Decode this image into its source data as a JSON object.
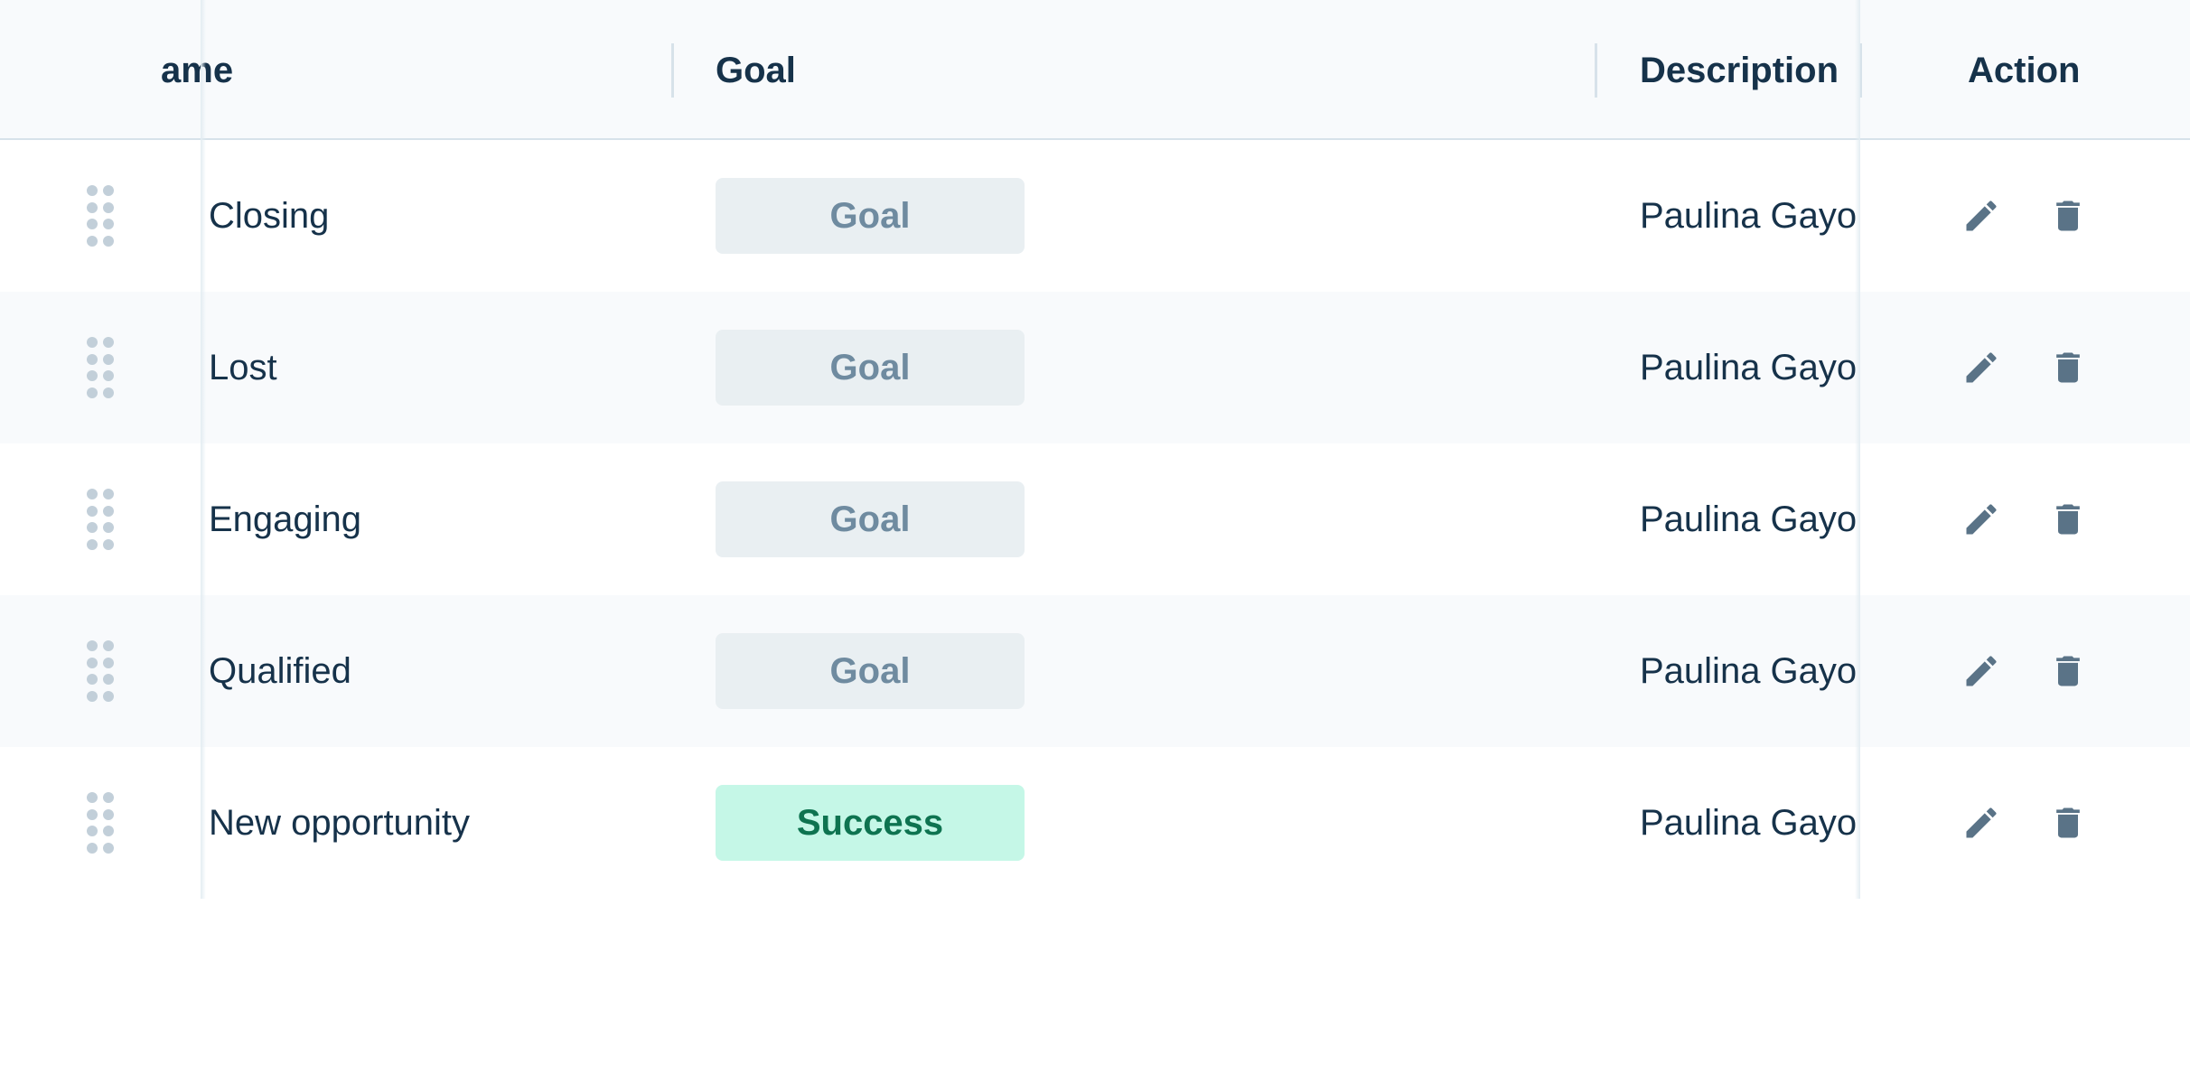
{
  "table": {
    "columns": {
      "name": "ame",
      "goal": "Goal",
      "description": "Description",
      "action": "Action"
    },
    "rows": [
      {
        "name": "Closing",
        "goal": "Goal",
        "goal_status": "neutral",
        "description": "Paulina Gayoso"
      },
      {
        "name": "Lost",
        "goal": "Goal",
        "goal_status": "neutral",
        "description": "Paulina Gayoso"
      },
      {
        "name": "Engaging",
        "goal": "Goal",
        "goal_status": "neutral",
        "description": "Paulina Gayoso"
      },
      {
        "name": "Qualified",
        "goal": "Goal",
        "goal_status": "neutral",
        "description": "Paulina Gayoso"
      },
      {
        "name": "New opportunity",
        "goal": "Success",
        "goal_status": "success",
        "description": "Paulina Gayoso"
      }
    ],
    "icons": {
      "drag": "drag-handle-icon",
      "edit": "pencil-icon",
      "delete": "trash-icon"
    },
    "colors": {
      "success_bg": "#c5f7e7",
      "success_text": "#0e7350",
      "neutral_bg": "#e9eff2",
      "neutral_text": "#6f8ba0"
    }
  }
}
